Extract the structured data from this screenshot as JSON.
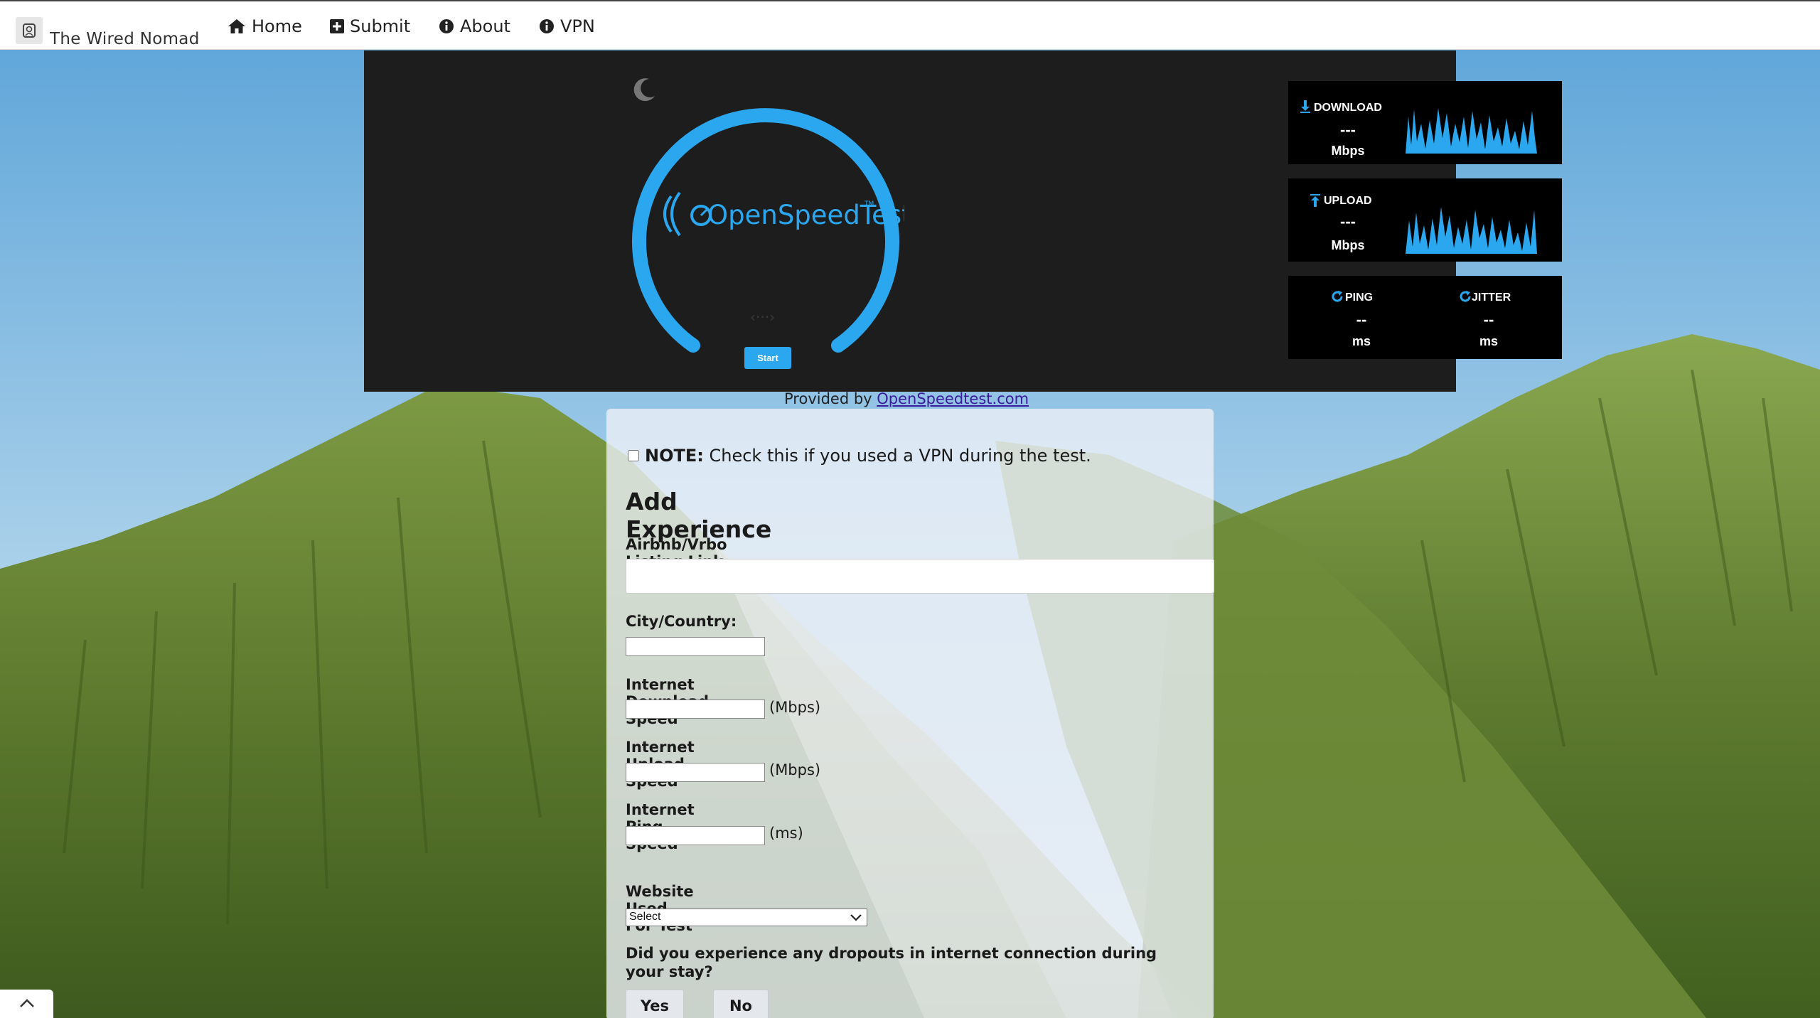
{
  "nav": {
    "brand": "The Wired Nomad",
    "items": [
      {
        "label": "Home",
        "icon": "home-icon"
      },
      {
        "label": "Submit",
        "icon": "plus-square-icon"
      },
      {
        "label": "About",
        "icon": "info-circle-icon"
      },
      {
        "label": "VPN",
        "icon": "info-circle-icon"
      }
    ]
  },
  "speedtest": {
    "logo_text": "OpenSpeedTest",
    "logo_tm": "TM",
    "download": {
      "label": "DOWNLOAD",
      "value": "---",
      "unit": "Mbps"
    },
    "upload": {
      "label": "UPLOAD",
      "value": "---",
      "unit": "Mbps"
    },
    "ping": {
      "label": "PING",
      "value": "--",
      "unit": "ms"
    },
    "jitter": {
      "label": "JITTER",
      "value": "--",
      "unit": "ms"
    },
    "start_label": "Start",
    "provided_by": "Provided by ",
    "provided_link": "OpenSpeedtest.com",
    "colors": {
      "accent": "#2aa7ee",
      "panel": "#1d1d1d",
      "box": "#000000"
    }
  },
  "form": {
    "vpn_note_bold": "NOTE:",
    "vpn_note_text": " Check this if you used a VPN during the test.",
    "heading": "Add Experience",
    "listing_label": "Airbnb/Vrbo Listing Link",
    "listing_value": "",
    "city_label": "City/Country:",
    "city_value": "",
    "download_label": "Internet Download Speed",
    "download_unit": "(Mbps)",
    "upload_label": "Internet Upload Speed",
    "upload_unit": "(Mbps)",
    "ping_label": "Internet Ping Speed",
    "ping_unit": "(ms)",
    "website_label": "Website Used For Test",
    "website_selected": "Select",
    "dropouts_question": "Did you experience any dropouts in internet connection during your stay?",
    "yes_label": "Yes",
    "no_label": "No"
  }
}
